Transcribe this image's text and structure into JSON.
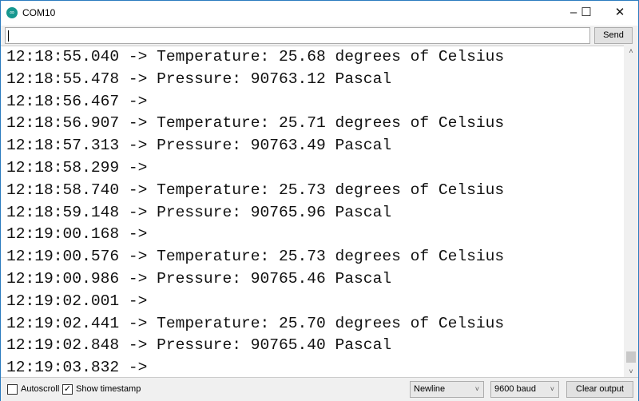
{
  "window": {
    "title": "COM10",
    "icon": "arduino-logo-icon",
    "minimize": "–",
    "maximize": "☐",
    "close": "✕"
  },
  "input": {
    "value": "",
    "send_label": "Send"
  },
  "output": {
    "lines": [
      "12:18:55.040 -> Temperature: 25.68 degrees of Celsius",
      "12:18:55.478 -> Pressure: 90763.12 Pascal",
      "12:18:56.467 -> ",
      "12:18:56.907 -> Temperature: 25.71 degrees of Celsius",
      "12:18:57.313 -> Pressure: 90763.49 Pascal",
      "12:18:58.299 -> ",
      "12:18:58.740 -> Temperature: 25.73 degrees of Celsius",
      "12:18:59.148 -> Pressure: 90765.96 Pascal",
      "12:19:00.168 -> ",
      "12:19:00.576 -> Temperature: 25.73 degrees of Celsius",
      "12:19:00.986 -> Pressure: 90765.46 Pascal",
      "12:19:02.001 -> ",
      "12:19:02.441 -> Temperature: 25.70 degrees of Celsius",
      "12:19:02.848 -> Pressure: 90765.40 Pascal",
      "12:19:03.832 -> "
    ]
  },
  "footer": {
    "autoscroll_label": "Autoscroll",
    "autoscroll_checked": false,
    "timestamp_label": "Show timestamp",
    "timestamp_checked": true,
    "line_ending": "Newline",
    "baud": "9600 baud",
    "clear_label": "Clear output"
  }
}
